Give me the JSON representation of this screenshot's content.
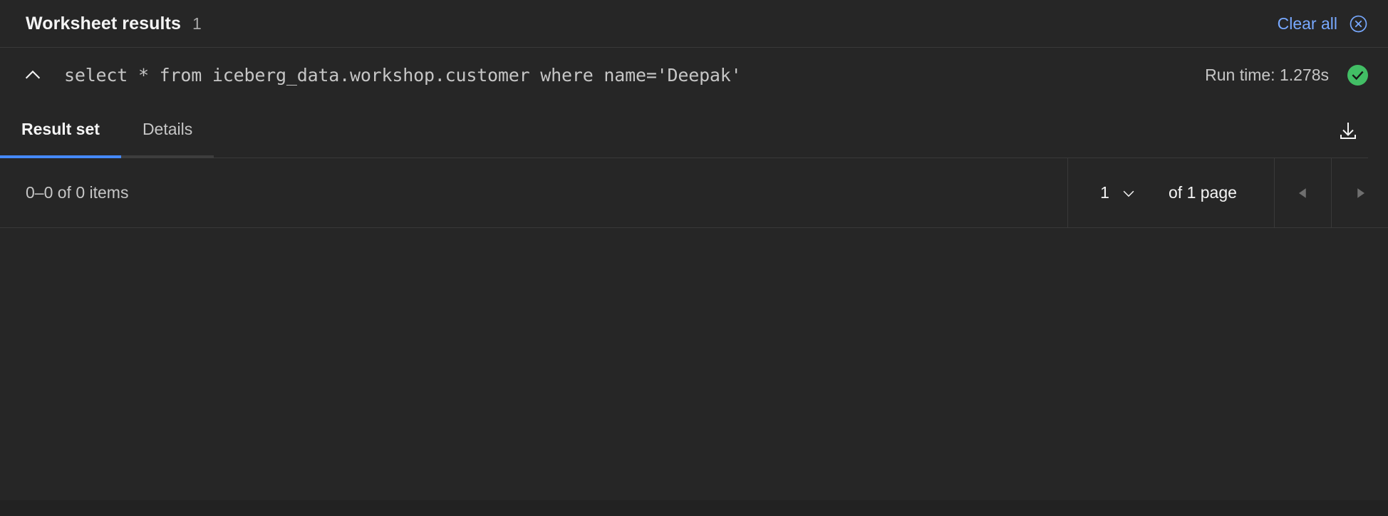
{
  "header": {
    "title": "Worksheet results",
    "count": "1",
    "clear_all_label": "Clear all",
    "clear_all_icon": "close-circle-icon",
    "accent_color": "#78a9ff"
  },
  "query": {
    "collapse_icon": "chevron-up-icon",
    "sql": "select * from iceberg_data.workshop.customer where name='Deepak'",
    "runtime_label": "Run time:",
    "runtime_value": "1.278s",
    "runtime_text": "Run time: 1.278s",
    "status_icon": "checkmark-filled-icon",
    "status_color": "#42be65"
  },
  "tabs": [
    {
      "label": "Result set",
      "active": true,
      "name": "tab-result-set"
    },
    {
      "label": "Details",
      "active": false,
      "name": "tab-details"
    }
  ],
  "toolbar": {
    "download_icon": "download-icon"
  },
  "pagination": {
    "items_text": "0–0 of 0 items",
    "page_value": "1",
    "page_dropdown_icon": "chevron-down-icon",
    "page_total_text": "of 1 page",
    "prev_icon": "caret-left-icon",
    "next_icon": "caret-right-icon"
  },
  "theme": {
    "panel_bg": "#262626",
    "border": "#393939",
    "tab_underline_active": "#4589ff",
    "tab_underline_inactive": "#3d3d3d",
    "text_primary": "#f4f4f4",
    "text_secondary": "#c6c6c6"
  }
}
